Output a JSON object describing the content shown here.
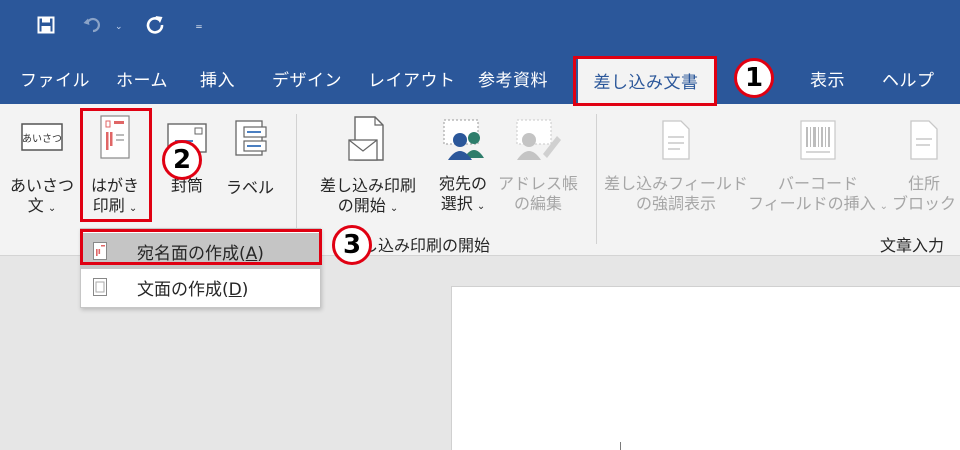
{
  "qat": {
    "save_icon": "save-icon",
    "undo_icon": "undo-icon",
    "redo_icon": "redo-icon",
    "customize_glyph": "₌"
  },
  "tabs": [
    {
      "label": "ファイル"
    },
    {
      "label": "ホーム"
    },
    {
      "label": "挿入"
    },
    {
      "label": "デザイン"
    },
    {
      "label": "レイアウト"
    },
    {
      "label": "参考資料"
    },
    {
      "label": "差し込み文書",
      "active": true
    },
    {
      "label": "表示"
    },
    {
      "label": "ヘルプ"
    }
  ],
  "ribbon": {
    "greeting": {
      "line1": "あいさつ",
      "line2": "文",
      "icon_text": "あいさつ"
    },
    "postcard": {
      "line1": "はがき",
      "line2": "印刷"
    },
    "envelope": {
      "line1": "封筒"
    },
    "labels": {
      "line1": "ラベル"
    },
    "start_merge": {
      "line1": "差し込み印刷",
      "line2": "の開始"
    },
    "select_recipients": {
      "line1": "宛先の",
      "line2": "選択"
    },
    "edit_address": {
      "line1": "アドレス帳",
      "line2": "の編集"
    },
    "highlight_fields": {
      "line1": "差し込みフィールド",
      "line2": "の強調表示"
    },
    "barcode": {
      "line1": "バーコード",
      "line2": "フィールドの挿入"
    },
    "address_block": {
      "line1": "住所",
      "line2": "ブロック"
    },
    "group_start_merge": "差し込み印刷の開始",
    "group_write_insert": "文章入力"
  },
  "menu": {
    "item1": {
      "label": "宛名面の作成(",
      "key": "A",
      "end": ")"
    },
    "item2": {
      "label": "文面の作成(",
      "key": "D",
      "end": ")"
    }
  },
  "annotations": {
    "step1": "1",
    "step2": "2",
    "step3": "3",
    "color": "#e00012"
  },
  "colors": {
    "brand": "#2b579a",
    "ribbon": "#f3f3f3",
    "canvas": "#e6e6e6"
  }
}
